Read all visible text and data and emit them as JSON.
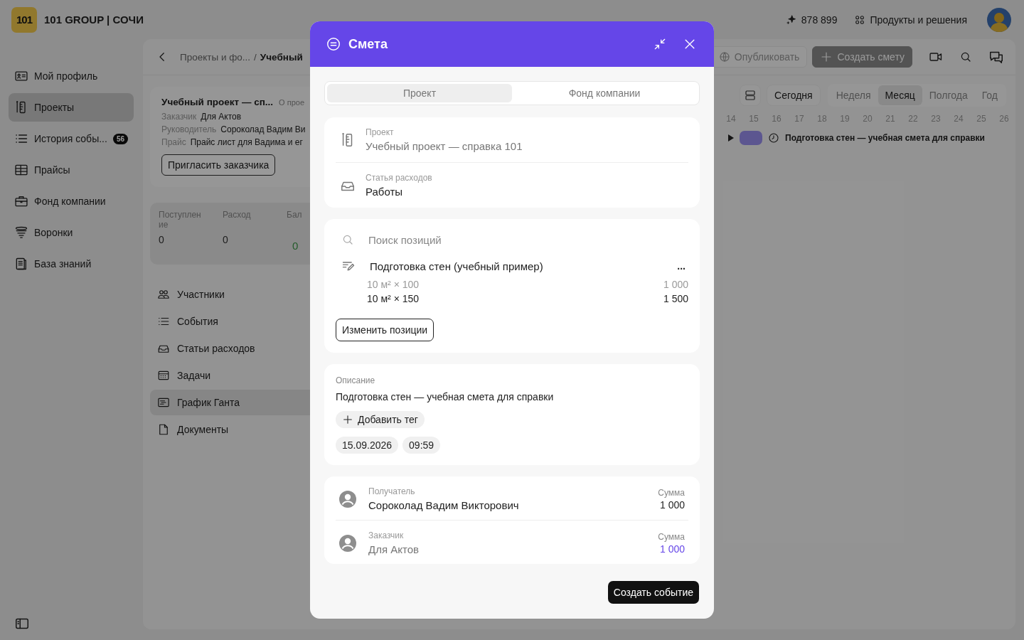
{
  "brand": {
    "logo": "101",
    "name": "101 GROUP | СОЧИ"
  },
  "header": {
    "credits": "878 899",
    "products": "Продукты и решения"
  },
  "sidebar": {
    "items": [
      {
        "label": "Мой профиль",
        "kind": "profile",
        "selected": false
      },
      {
        "label": "Проекты",
        "kind": "projects",
        "selected": true
      },
      {
        "label": "История собы...",
        "kind": "history",
        "selected": false,
        "badge": "56"
      },
      {
        "label": "Прайсы",
        "kind": "prices",
        "selected": false
      },
      {
        "label": "Фонд компании",
        "kind": "fund",
        "selected": false
      },
      {
        "label": "Воронки",
        "kind": "funnels",
        "selected": false
      },
      {
        "label": "База знаний",
        "kind": "knowledge",
        "selected": false
      }
    ]
  },
  "breadcrumb": {
    "items": [
      "Проекты и фо...",
      "Учебный"
    ],
    "separator": "/"
  },
  "project_card": {
    "title": "Учебный проект — сп...",
    "about": "О прое",
    "fields": [
      {
        "label": "Заказчик",
        "value": "Для Актов"
      },
      {
        "label": "Руководитель",
        "value": "Сороколад Вадим Ви"
      },
      {
        "label": "Прайс",
        "value": "Прайс лист для Вадима и ег"
      }
    ],
    "invite_button": "Пригласить заказчика"
  },
  "totals": [
    {
      "label": "Поступление",
      "value": "0",
      "positive": false
    },
    {
      "label": "Расход",
      "value": "0",
      "positive": false
    },
    {
      "label": "Бал",
      "value": "0",
      "positive": true
    }
  ],
  "project_nav": [
    {
      "label": "Участники",
      "kind": "participants",
      "selected": false
    },
    {
      "label": "События",
      "kind": "events",
      "selected": false
    },
    {
      "label": "Статьи расходов",
      "kind": "expenses",
      "selected": false
    },
    {
      "label": "Задачи",
      "kind": "tasks",
      "selected": false
    },
    {
      "label": "График Ганта",
      "kind": "gantt",
      "selected": true
    },
    {
      "label": "Документы",
      "kind": "documents",
      "selected": false
    }
  ],
  "toolbar": {
    "publish": "Опубликовать",
    "create": "Создать смету"
  },
  "gantt": {
    "today": "Сегодня",
    "periods": [
      {
        "label": "Неделя",
        "selected": false
      },
      {
        "label": "Месяц",
        "selected": true
      },
      {
        "label": "Полгода",
        "selected": false
      },
      {
        "label": "Год",
        "selected": false
      }
    ],
    "days": [
      "14",
      "15",
      "16",
      "17",
      "18",
      "19",
      "20",
      "21",
      "22",
      "23",
      "24",
      "25",
      "26"
    ],
    "rows": [
      {
        "title": "Подготовка стен — учебная смета для справки",
        "expanded": false
      }
    ]
  },
  "modal": {
    "title": "Смета",
    "tabs": [
      {
        "label": "Проект",
        "selected": true
      },
      {
        "label": "Фонд компании",
        "selected": false
      }
    ],
    "project": {
      "label": "Проект",
      "value": "Учебный проект — справка 101",
      "muted": true
    },
    "expense": {
      "label": "Статья расходов",
      "value": "Работы",
      "muted": false
    },
    "search": {
      "placeholder": "Поиск позиций"
    },
    "position": {
      "name": "Подготовка стен (учебный пример)",
      "more": "...",
      "lines": [
        {
          "qty": "10 м² × 100",
          "amount": "1 000",
          "muted": true
        },
        {
          "qty": "10 м² × 150",
          "amount": "1 500",
          "muted": false
        }
      ]
    },
    "edit_button": "Изменить позиции",
    "description": {
      "label": "Описание",
      "text": "Подготовка стен — учебная смета для справки"
    },
    "add_tag": "Добавить тег",
    "date": "15.09.2026",
    "time": "09:59",
    "parties": [
      {
        "role": "Получатель",
        "name": "Сороколад Вадим Викторович",
        "sum_label": "Сумма",
        "sum": "1 000",
        "muted": false,
        "highlight": false
      },
      {
        "role": "Заказчик",
        "name": "Для Актов",
        "sum_label": "Сумма",
        "sum": "1 000",
        "muted": true,
        "highlight": true
      }
    ],
    "submit": "Создать событие"
  }
}
